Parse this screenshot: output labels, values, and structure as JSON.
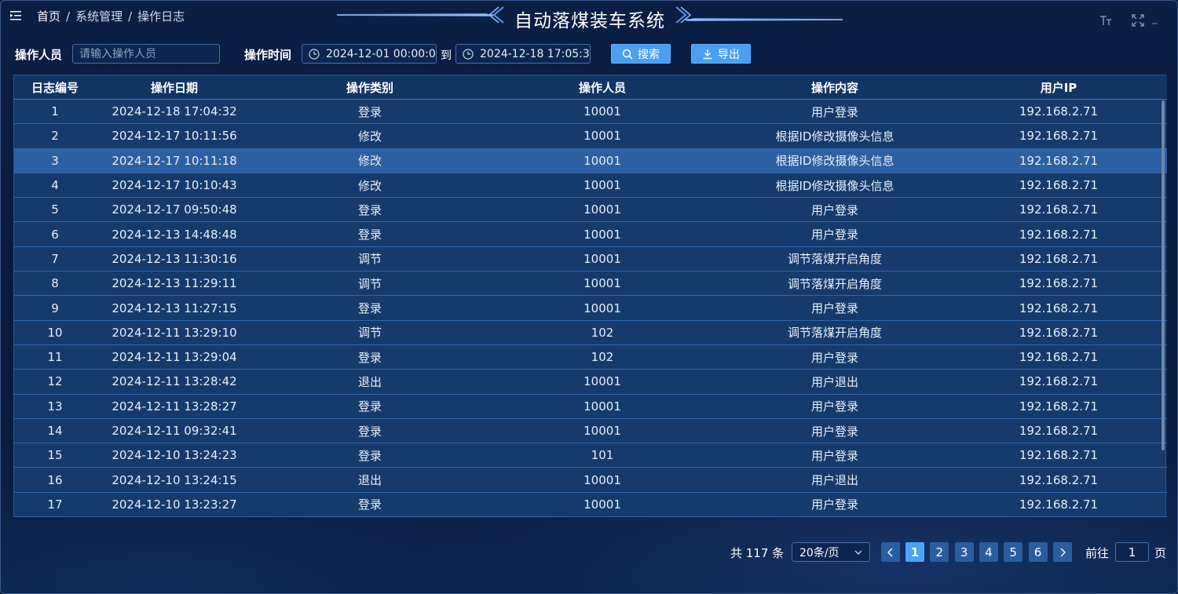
{
  "header": {
    "title": "自动落煤装车系统",
    "breadcrumb": [
      "首页",
      "系统管理",
      "操作日志"
    ],
    "separator": "/",
    "font_size_icon": "font-size-icon",
    "fullscreen_icon": "fullscreen-icon",
    "minimize_label": "_"
  },
  "filters": {
    "operator_label": "操作人员",
    "operator_placeholder": "请输入操作人员",
    "operator_value": "",
    "time_label": "操作时间",
    "start_time": "2024-12-01 00:00:00",
    "to_label": "到",
    "end_time": "2024-12-18 17:05:30",
    "search_label": "搜索",
    "export_label": "导出"
  },
  "table": {
    "columns": [
      "日志编号",
      "操作日期",
      "操作类别",
      "操作人员",
      "操作内容",
      "用户IP"
    ],
    "selected_row": 3,
    "rows": [
      [
        "1",
        "2024-12-18 17:04:32",
        "登录",
        "10001",
        "用户登录",
        "192.168.2.71"
      ],
      [
        "2",
        "2024-12-17 10:11:56",
        "修改",
        "10001",
        "根据ID修改摄像头信息",
        "192.168.2.71"
      ],
      [
        "3",
        "2024-12-17 10:11:18",
        "修改",
        "10001",
        "根据ID修改摄像头信息",
        "192.168.2.71"
      ],
      [
        "4",
        "2024-12-17 10:10:43",
        "修改",
        "10001",
        "根据ID修改摄像头信息",
        "192.168.2.71"
      ],
      [
        "5",
        "2024-12-17 09:50:48",
        "登录",
        "10001",
        "用户登录",
        "192.168.2.71"
      ],
      [
        "6",
        "2024-12-13 14:48:48",
        "登录",
        "10001",
        "用户登录",
        "192.168.2.71"
      ],
      [
        "7",
        "2024-12-13 11:30:16",
        "调节",
        "10001",
        "调节落煤开启角度",
        "192.168.2.71"
      ],
      [
        "8",
        "2024-12-13 11:29:11",
        "调节",
        "10001",
        "调节落煤开启角度",
        "192.168.2.71"
      ],
      [
        "9",
        "2024-12-13 11:27:15",
        "登录",
        "10001",
        "用户登录",
        "192.168.2.71"
      ],
      [
        "10",
        "2024-12-11 13:29:10",
        "调节",
        "102",
        "调节落煤开启角度",
        "192.168.2.71"
      ],
      [
        "11",
        "2024-12-11 13:29:04",
        "登录",
        "102",
        "用户登录",
        "192.168.2.71"
      ],
      [
        "12",
        "2024-12-11 13:28:42",
        "退出",
        "10001",
        "用户退出",
        "192.168.2.71"
      ],
      [
        "13",
        "2024-12-11 13:28:27",
        "登录",
        "10001",
        "用户登录",
        "192.168.2.71"
      ],
      [
        "14",
        "2024-12-11 09:32:41",
        "登录",
        "10001",
        "用户登录",
        "192.168.2.71"
      ],
      [
        "15",
        "2024-12-10 13:24:23",
        "登录",
        "101",
        "用户登录",
        "192.168.2.71"
      ],
      [
        "16",
        "2024-12-10 13:24:15",
        "退出",
        "10001",
        "用户退出",
        "192.168.2.71"
      ],
      [
        "17",
        "2024-12-10 13:23:27",
        "登录",
        "10001",
        "用户登录",
        "192.168.2.71"
      ]
    ]
  },
  "pagination": {
    "total_text": "共 117 条",
    "page_size": "20条/页",
    "pages": [
      "1",
      "2",
      "3",
      "4",
      "5",
      "6"
    ],
    "current_page": "1",
    "goto_label": "前往",
    "goto_value": "1",
    "page_suffix": "页"
  },
  "colors": {
    "accent": "#4a9ff0",
    "background": "#0a1d3f",
    "table_bg": "#163a6c",
    "selected_row": "#2d5fa3"
  }
}
